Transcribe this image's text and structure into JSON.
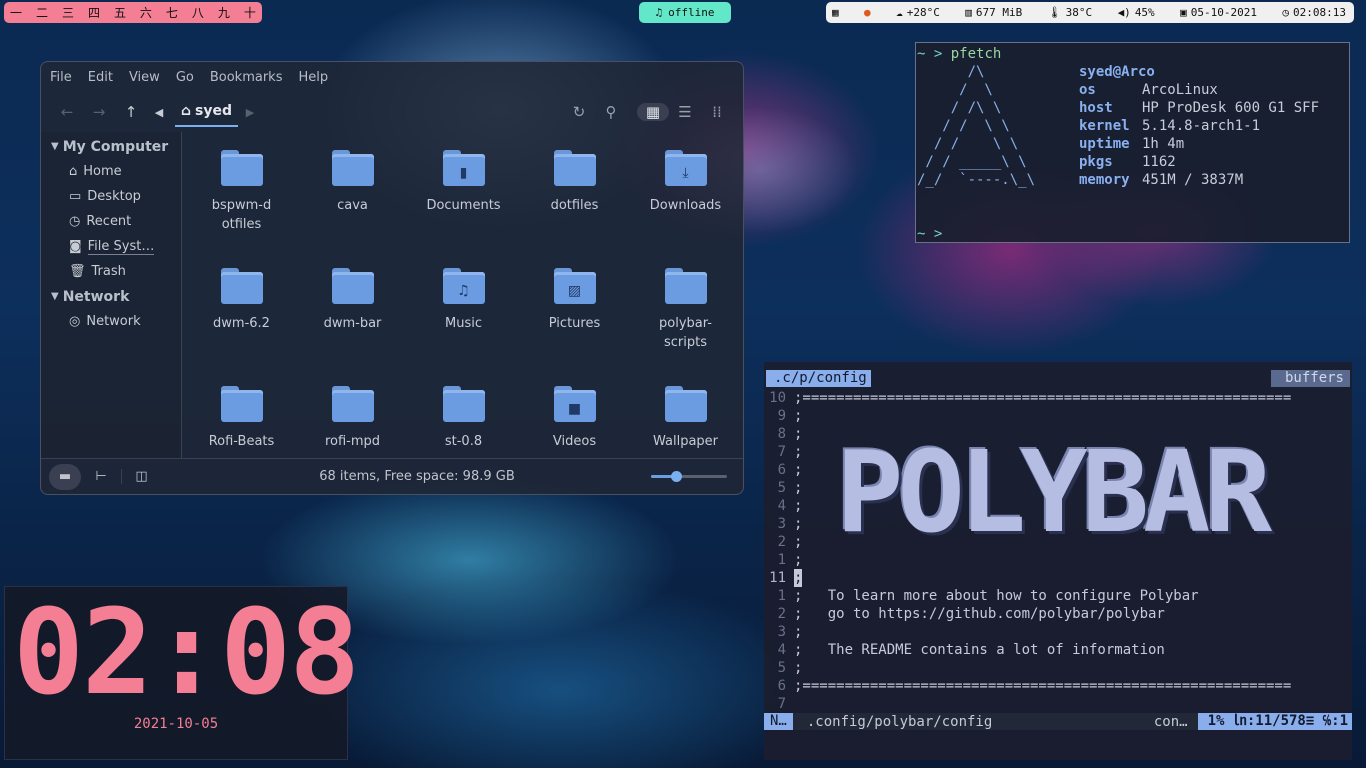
{
  "topbar": {
    "workspaces": [
      "一",
      "二",
      "三",
      "四",
      "五",
      "六",
      "七",
      "八",
      "九",
      "十"
    ],
    "mpd": "offline",
    "weather": "+28°C",
    "memory": "677 MiB",
    "temp": "38°C",
    "volume": "45%",
    "date": "05-10-2021",
    "time": "02:08:13"
  },
  "fm": {
    "menu": [
      "File",
      "Edit",
      "View",
      "Go",
      "Bookmarks",
      "Help"
    ],
    "location": "syed",
    "sidebar": {
      "computer_header": "My Computer",
      "computer_items": [
        "Home",
        "Desktop",
        "Recent",
        "File Syst…",
        "Trash"
      ],
      "network_header": "Network",
      "network_items": [
        "Network"
      ]
    },
    "items": [
      "bspwm-dotfiles",
      "cava",
      "Documents",
      "dotfiles",
      "Downloads",
      "dwm-6.2",
      "dwm-bar",
      "Music",
      "Pictures",
      "polybar-scripts",
      "Rofi-Beats",
      "rofi-mpd",
      "st-0.8",
      "Videos",
      "Wallpaper"
    ],
    "status": "68 items, Free space: 98.9 GB",
    "zoom_level": 0.33
  },
  "term": {
    "prompt": "~ >",
    "command": "pfetch",
    "title": "syed@Arco",
    "info": [
      [
        "os",
        "ArcoLinux"
      ],
      [
        "host",
        "HP ProDesk 600 G1 SFF"
      ],
      [
        "kernel",
        "5.14.8-arch1-1"
      ],
      [
        "uptime",
        "1h 4m"
      ],
      [
        "pkgs",
        "1162"
      ],
      [
        "memory",
        "451M / 3837M"
      ]
    ],
    "logo": [
      "      /\\",
      "     /  \\",
      "    / /\\ \\",
      "   / /  \\ \\",
      "  / /    \\ \\",
      " / / _____\\ \\",
      "/_/  `----.\\_\\"
    ]
  },
  "vim": {
    "tab": ".c/p/config",
    "buffers": "buffers",
    "art": "POLYBAR",
    "lines": [
      [
        "10",
        ";=========================================================="
      ],
      [
        "9",
        ";"
      ],
      [
        "8",
        ";"
      ],
      [
        "7",
        ";"
      ],
      [
        "6",
        ";"
      ],
      [
        "5",
        ";"
      ],
      [
        "4",
        ";"
      ],
      [
        "3",
        ";"
      ],
      [
        "2",
        ";"
      ],
      [
        "1",
        ";"
      ],
      [
        "11",
        ";"
      ],
      [
        "1",
        ";   To learn more about how to configure Polybar"
      ],
      [
        "2",
        ";   go to https://github.com/polybar/polybar"
      ],
      [
        "3",
        ";"
      ],
      [
        "4",
        ";   The README contains a lot of information"
      ],
      [
        "5",
        ";"
      ],
      [
        "6",
        ";=========================================================="
      ],
      [
        "7",
        ""
      ]
    ],
    "mode": "N…",
    "file": ".config/polybar/config",
    "ftype": "con…",
    "position": "1% ㏑:11/578≡ ℅:1"
  },
  "clock": {
    "time": "02:08",
    "date": "2021-10-05"
  },
  "colors": {
    "accent": "#f47e93",
    "vim_accent": "#8aaeec",
    "mpd": "#62e8c8"
  }
}
